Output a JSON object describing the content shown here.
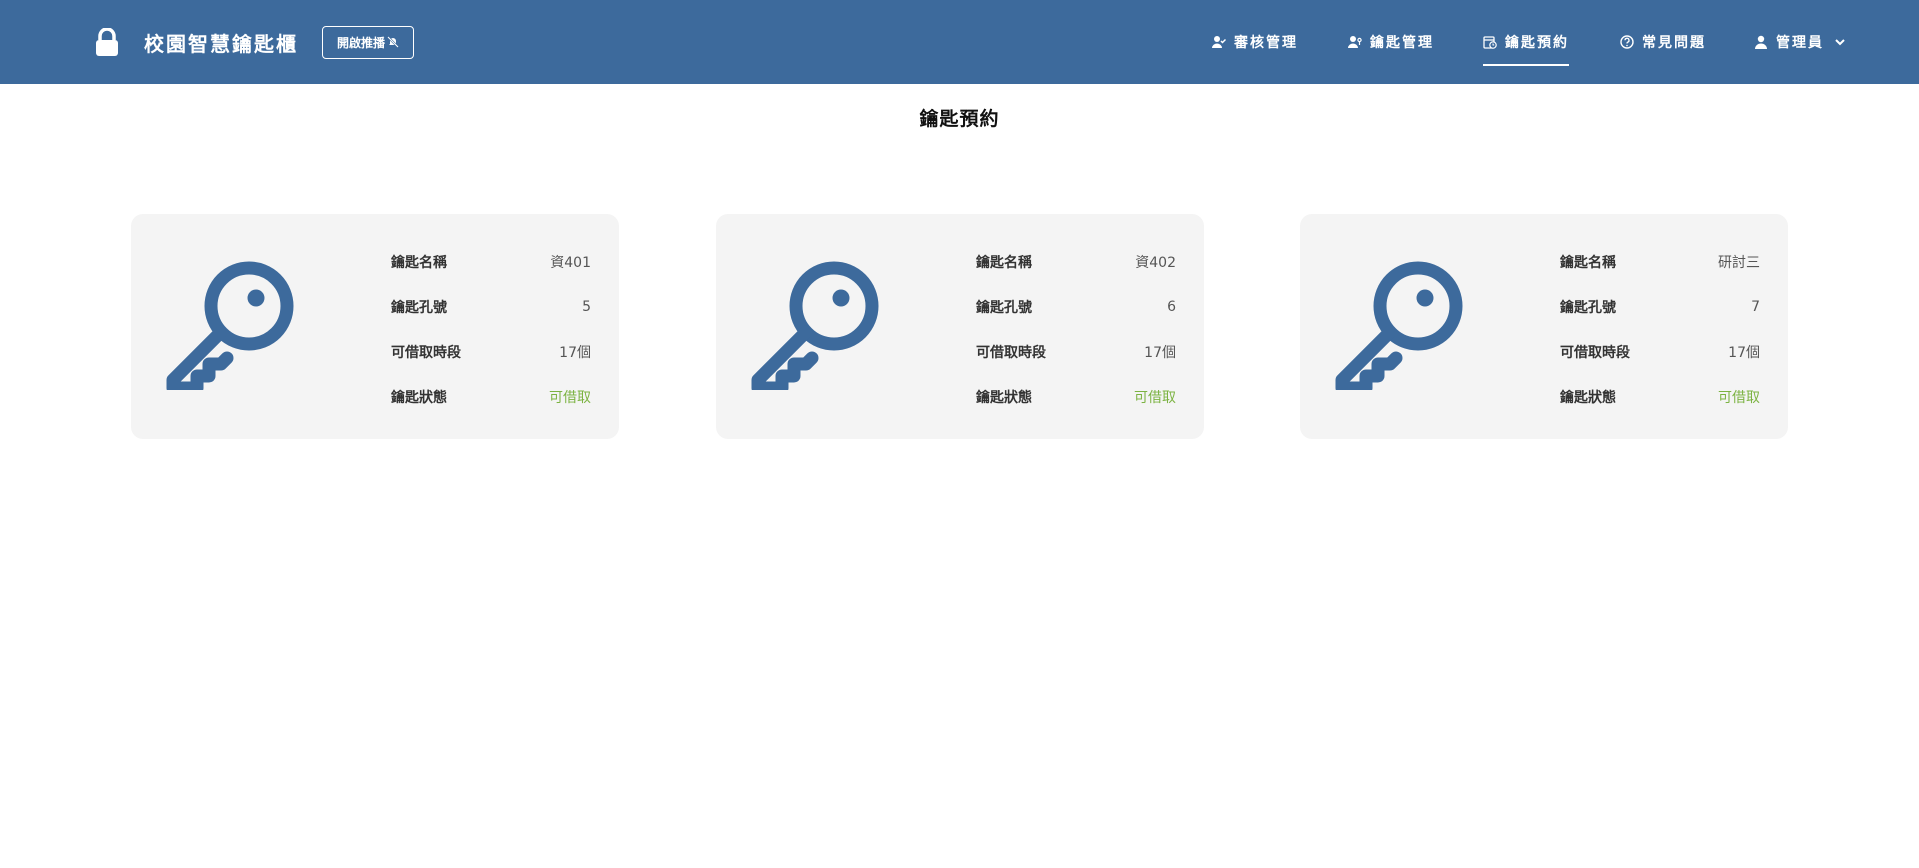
{
  "header": {
    "title": "校園智慧鑰匙櫃",
    "push_button_label": "開啟推播",
    "nav": {
      "review": "審核管理",
      "keys": "鑰匙管理",
      "reserve": "鑰匙預約",
      "faq": "常見問題",
      "user": "管理員"
    }
  },
  "page": {
    "title": "鑰匙預約"
  },
  "labels": {
    "name": "鑰匙名稱",
    "slot": "鑰匙孔號",
    "periods": "可借取時段",
    "status": "鑰匙狀態"
  },
  "cards": [
    {
      "name": "資401",
      "slot": "5",
      "periods": "17個",
      "status": "可借取"
    },
    {
      "name": "資402",
      "slot": "6",
      "periods": "17個",
      "status": "可借取"
    },
    {
      "name": "研討三",
      "slot": "7",
      "periods": "17個",
      "status": "可借取"
    }
  ],
  "colors": {
    "navbar": "#3d6a9c",
    "key_icon": "#3d6a9c",
    "card_bg": "#f4f4f4",
    "status_available": "#7cb342"
  },
  "icons": {
    "brand": "lock-icon",
    "push": "bell-slash-icon",
    "review": "user-check-icon",
    "keys": "user-key-icon",
    "reserve": "calendar-clock-icon",
    "faq": "question-circle-icon",
    "user": "user-icon",
    "card": "key-icon"
  }
}
